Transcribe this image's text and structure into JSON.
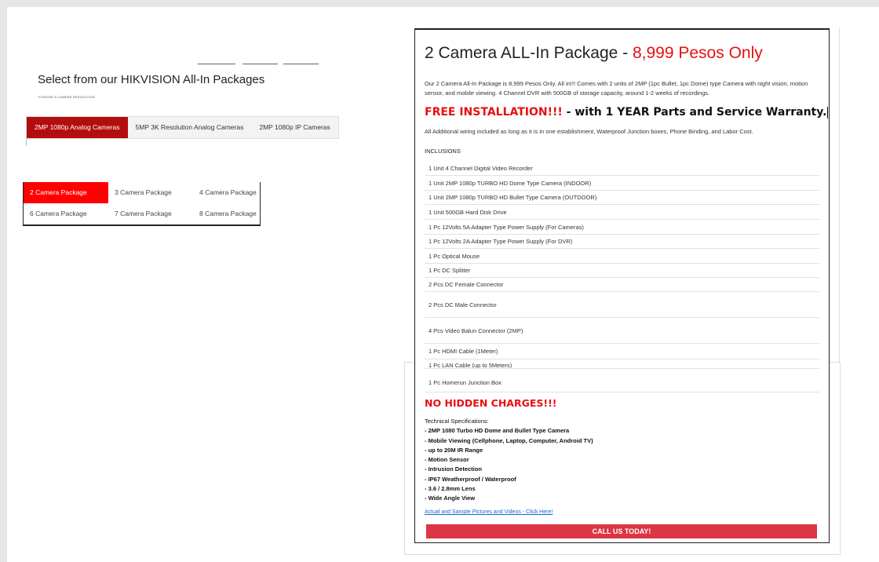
{
  "left": {
    "title": "Select from our HIKVISION All-In Packages",
    "note": "*CHOOSE A CAMERA RESOLUTION",
    "resolution_tabs": [
      {
        "label": "2MP 1080p Analog Cameras",
        "active": true
      },
      {
        "label": "5MP 3K Resolution Analog Cameras",
        "active": false
      },
      {
        "label": "2MP 1080p IP Cameras",
        "active": false
      }
    ],
    "package_tabs": [
      {
        "label": "2 Camera Package",
        "active": true
      },
      {
        "label": "3 Camera Package",
        "active": false
      },
      {
        "label": "4 Camera Package",
        "active": false
      },
      {
        "label": "6 Camera Package",
        "active": false
      },
      {
        "label": "7 Camera Package",
        "active": false
      },
      {
        "label": "8 Camera Package",
        "active": false
      }
    ]
  },
  "card": {
    "heading": "2 Camera ALL-In Package - ",
    "price": "8,999 Pesos Only",
    "description": "Our 2 Camera All-In Package is 8,999 Pesos Only. All in!!! Comes with 2 units of 2MP (1pc Bullet, 1pc Dome) type Camera with night vision, motion sensor, and mobile viewing. 4 Channel DVR with 500GB of storage capacity, around 1-2 weeks of recordings.",
    "free_install_red": "FREE INSTALLATION!!!",
    "free_install_rest": " - with 1 YEAR Parts and Service Warranty.",
    "additional": "All Additional wiring included as long as it is in one establishment, Waterproof Junction boxes, Phone Binding, and Labor Cost.",
    "inclusions_label": "INCLUSIONS",
    "inclusions": [
      "1 Unit 4 Channel Digital Video Recorder",
      "1 Unit 2MP 1080p TURBO HD Dome Type Camera (INDOOR)",
      "1 Unit 2MP 1080p TURBO HD Bullet Type Camera (OUTDOOR)",
      "1 Unit 500GB Hard Disk Drive",
      "1 Pc 12Volts 5A Adapter Type Power Supply (For Cameras)",
      "1 Pc 12Volts 2A Adapter Type Power Supply (For DVR)",
      "1 Pc Optical Mouse",
      "1 Pc DC Splitter",
      "2 Pcs DC Female Connector",
      "2 Pcs DC Male Connector",
      "4 Pcs Video Balun Connector (2MP)",
      "1 Pc HDMI Cable (1Meter)",
      "1 Pc LAN Cable (up to 5Meters)",
      "1 Pc Homerun Junction Box"
    ],
    "no_hidden": "NO HIDDEN CHARGES!!!",
    "specs_title": "Technical Specifications:",
    "specs": [
      "- 2MP 1080 Turbo HD Dome and Bullet Type Camera",
      "- Mobile Viewing (Cellphone, Laptop, Computer, Android TV)",
      "- up to 20M IR Range",
      "- Motion Sensor",
      "- Intrusion Detection",
      "- IP67 Weatherproof / Waterproof",
      "- 3.6 / 2.8mm Lens",
      "- Wide Angle View"
    ],
    "link": "Actual and Sample Pictures and Videos - Click Here!",
    "cta": "CALL US TODAY!"
  }
}
